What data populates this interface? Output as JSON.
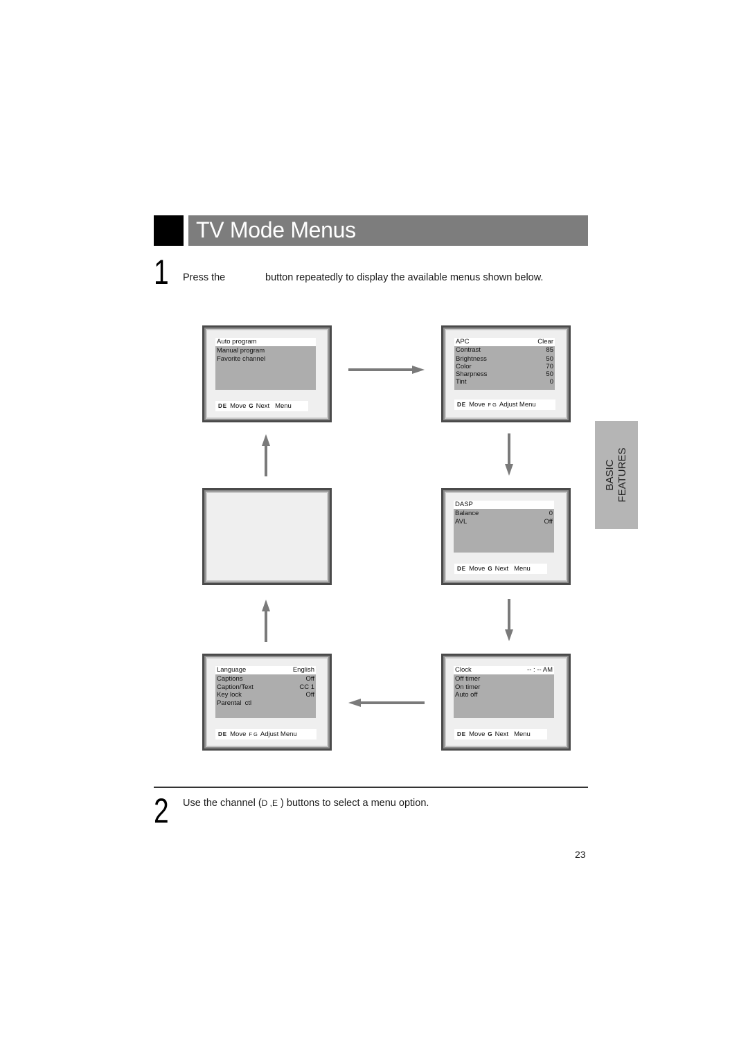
{
  "page": {
    "title": "TV Mode Menus",
    "side_tab": [
      "BASIC",
      "FEATURES"
    ],
    "page_number": "23"
  },
  "steps": [
    {
      "number": "1",
      "text_before": "Press the",
      "text_after": "button repeatedly to display the available menus shown below."
    },
    {
      "number": "2",
      "text_before": "Use the channel (",
      "keys": "D ,E",
      "text_after": " ) buttons to select a menu option."
    }
  ],
  "screens": {
    "setup": {
      "header": {
        "label": "Auto program",
        "value": ""
      },
      "items": [
        {
          "label": "Manual program",
          "value": ""
        },
        {
          "label": "Favorite channel",
          "value": ""
        }
      ],
      "footer": {
        "keys1": "DE",
        "action1": "Move",
        "keys2": "G",
        "action2": "Next",
        "action3": "Menu"
      }
    },
    "picture": {
      "header": {
        "label": "APC",
        "value": "Clear"
      },
      "items": [
        {
          "label": "Contrast",
          "value": "85"
        },
        {
          "label": "Brightness",
          "value": "50"
        },
        {
          "label": "Color",
          "value": "70"
        },
        {
          "label": "Sharpness",
          "value": "50"
        },
        {
          "label": "Tint",
          "value": "0"
        }
      ],
      "footer": {
        "keys1": "DE",
        "action1": "Move",
        "keys2": "F G",
        "action2": "Adjust",
        "action3": "Menu"
      }
    },
    "blank": {},
    "sound": {
      "header": {
        "label": "DASP",
        "value": ""
      },
      "items": [
        {
          "label": "Balance",
          "value": "0"
        },
        {
          "label": "AVL",
          "value": "Off"
        }
      ],
      "footer": {
        "keys1": "DE",
        "action1": "Move",
        "keys2": "G",
        "action2": "Next",
        "action3": "Menu"
      }
    },
    "special": {
      "header": {
        "label": "Language",
        "value": "English"
      },
      "items": [
        {
          "label": "Captions",
          "value": "Off"
        },
        {
          "label": "Caption/Text",
          "value": "CC 1"
        },
        {
          "label": "Key lock",
          "value": "Off"
        },
        {
          "label": "Parental  ctl",
          "value": ""
        }
      ],
      "footer": {
        "keys1": "DE",
        "action1": "Move",
        "keys2": "F G",
        "action2": "Adjust",
        "action3": "Menu"
      }
    },
    "time": {
      "header": {
        "label": "Clock",
        "value": "-- : -- AM"
      },
      "items": [
        {
          "label": "Off timer",
          "value": ""
        },
        {
          "label": "On timer",
          "value": ""
        },
        {
          "label": "Auto off",
          "value": ""
        }
      ],
      "footer": {
        "keys1": "DE",
        "action1": "Move",
        "keys2": "G",
        "action2": "Next",
        "action3": "Menu"
      }
    }
  },
  "arrows": [
    {
      "name": "arrow-right",
      "direction": "right",
      "from": "setup",
      "to": "picture"
    },
    {
      "name": "arrow-down-1",
      "direction": "down",
      "from": "picture",
      "to": "sound"
    },
    {
      "name": "arrow-down-2",
      "direction": "down",
      "from": "sound",
      "to": "time"
    },
    {
      "name": "arrow-left",
      "direction": "left",
      "from": "time",
      "to": "special"
    },
    {
      "name": "arrow-up-1",
      "direction": "up",
      "from": "special",
      "to": "blank"
    },
    {
      "name": "arrow-up-2",
      "direction": "up",
      "from": "blank",
      "to": "setup"
    }
  ],
  "colors": {
    "title_bar": "#7d7d7d",
    "menu_highlight": "#adadad",
    "screen_bg": "#efefef",
    "side_tab": "#b5b5b5",
    "arrow": "#7a7a7a"
  }
}
